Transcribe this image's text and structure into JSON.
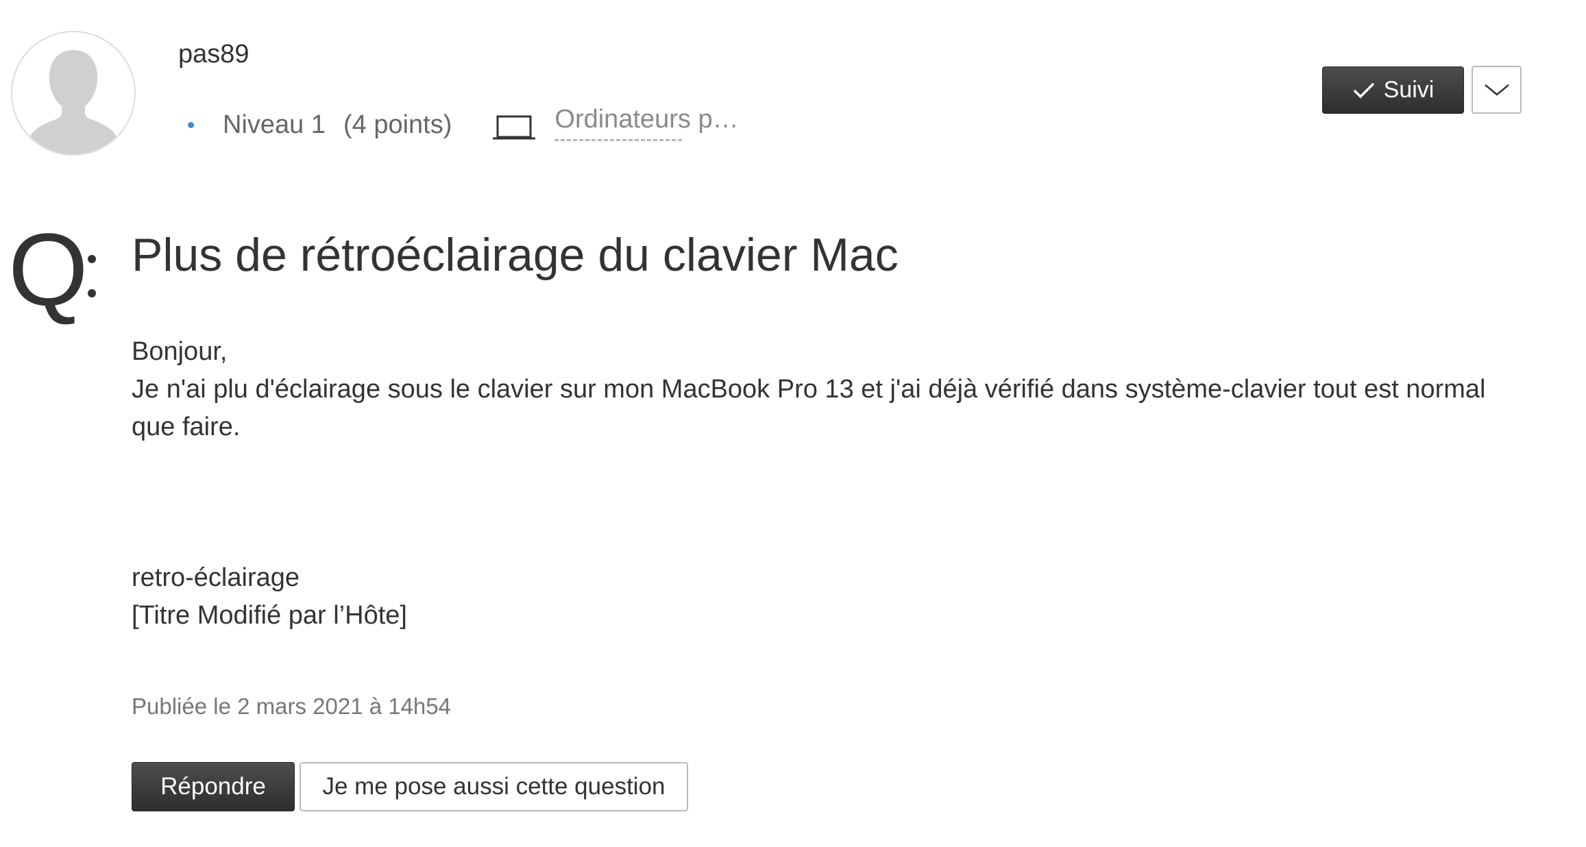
{
  "author": {
    "name": "pas89",
    "avatar_icon": "default-user-silhouette-icon",
    "level": "Niveau 1",
    "points": "(4 points)",
    "device_icon": "laptop-icon",
    "device": "Ordinateurs p…"
  },
  "follow": {
    "label": "Suivi",
    "check_icon": "checkmark-icon",
    "dropdown_icon": "chevron-down-icon"
  },
  "question": {
    "q_label": "Q",
    "title": "Plus de rétroéclairage du clavier Mac",
    "body": {
      "greeting": "Bonjour,",
      "text": "Je n'ai plu d'éclairage sous le clavier sur mon MacBook Pro 13 et j'ai déjà vérifié dans système-clavier tout est normal que faire.",
      "tag": "retro-éclairage",
      "note": "[Titre Modifié par l’Hôte]"
    },
    "posted": "Publiée le 2 mars 2021 à 14h54"
  },
  "actions": {
    "reply_label": "Répondre",
    "same_question_label": "Je me pose aussi cette question"
  },
  "colors": {
    "dark_button": "#3a3a3a",
    "level_dot": "#4a87c8",
    "text": "#333333",
    "muted": "#777777"
  }
}
